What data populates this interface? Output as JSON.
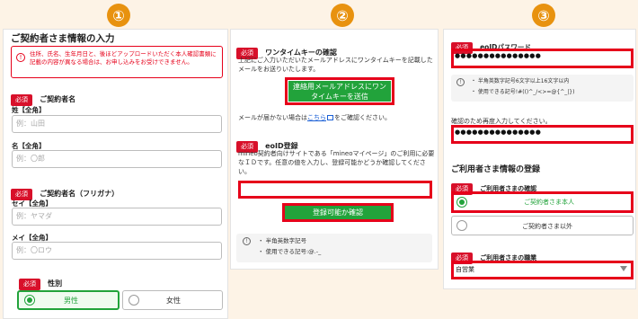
{
  "steps": [
    "①",
    "②",
    "③"
  ],
  "panel1": {
    "title": "ご契約者さま情報の入力",
    "notice": "住所、氏名、生年月日と、後ほどアップロードいただく本人確認書類に記載の内容が異なる場合は、お申し込みをお受けできません。",
    "required": "必須",
    "contractor_name": "ご契約者名",
    "sei_label": "姓【全角】",
    "sei_placeholder": "例：山田",
    "mei_label": "名【全角】",
    "mei_placeholder": "例：〇郎",
    "kana_label": "ご契約者名（フリガナ）",
    "sei_kana_label": "セイ【全角】",
    "sei_kana_placeholder": "例：ヤマダ",
    "mei_kana_label": "メイ【全角】",
    "mei_kana_placeholder": "例：〇ロウ",
    "gender_label": "性別",
    "male": "男性",
    "female": "女性"
  },
  "panel2": {
    "required": "必須",
    "otk_title": "ワンタイムキーの確認",
    "otk_desc": "上記にご入力いただいたメールアドレスにワンタイムキーを記載したメールをお送りいたします。",
    "send_button": "連絡用メールアドレスにワンタイムキーを送信",
    "no_mail_prefix": "メールが届かない場合は",
    "no_mail_link": "こちら",
    "no_mail_suffix": "をご確認ください。",
    "eoid_title": "eoID登録",
    "eoid_desc": "mineo契約者向けサイトである「mineoマイページ」のご利用に必要なＩＤです。任意の値を入力し、登録可能かどうか確認してください。",
    "check_button": "登録可能か確認",
    "hint1": "半角英数字記号",
    "hint2": "使用できる記号:@.-_"
  },
  "panel3": {
    "required": "必須",
    "pw_title": "eoIDパスワード",
    "pw_value": "●●●●●●●●●●●●●●●",
    "pw_hint1": "半角英数字記号6文字以上16文字以内",
    "pw_hint2": "使用できる記号!#(()^_/<>=@{^_|})",
    "confirm_label": "確認のため再度入力してください。",
    "confirm_value": "●●●●●●●●●●●●●●●",
    "user_title": "ご利用者さま情報の登録",
    "user_confirm_label": "ご利用者さまの確認",
    "option_self": "ご契約者さま本人",
    "option_other": "ご契約者さま以外",
    "job_label": "ご利用者さまの職業",
    "job_value": "自営業"
  }
}
